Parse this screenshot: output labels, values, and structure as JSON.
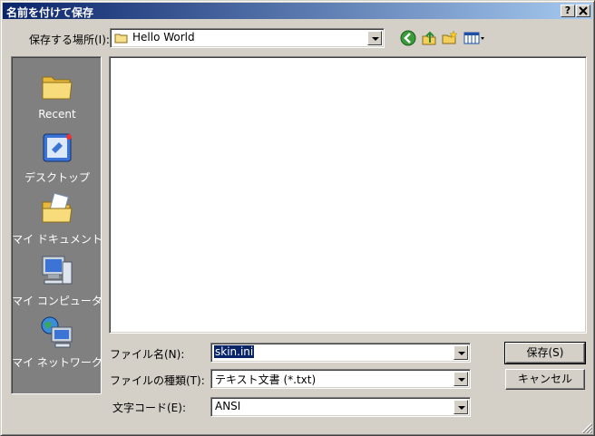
{
  "window": {
    "title": "名前を付けて保存",
    "help_button": "?",
    "close_button": "X"
  },
  "save_in": {
    "label": "保存する場所(I):",
    "value": "Hello World"
  },
  "toolbar": {
    "icons": [
      "back-icon",
      "up-folder-icon",
      "new-folder-icon",
      "view-menu-icon"
    ]
  },
  "places": [
    {
      "label": "Recent",
      "icon": "recent-folder-icon"
    },
    {
      "label": "デスクトップ",
      "icon": "desktop-icon"
    },
    {
      "label": "マイ ドキュメント",
      "icon": "my-documents-icon"
    },
    {
      "label": "マイ コンピュータ",
      "icon": "my-computer-icon"
    },
    {
      "label": "マイ ネットワーク",
      "icon": "my-network-icon"
    }
  ],
  "filename": {
    "label": "ファイル名(N):",
    "value": "skin.ini"
  },
  "filetype": {
    "label": "ファイルの種類(T):",
    "value": "テキスト文書 (*.txt)"
  },
  "encoding": {
    "label": "文字コード(E):",
    "value": "ANSI"
  },
  "buttons": {
    "save": "保存(S)",
    "cancel": "キャンセル"
  }
}
